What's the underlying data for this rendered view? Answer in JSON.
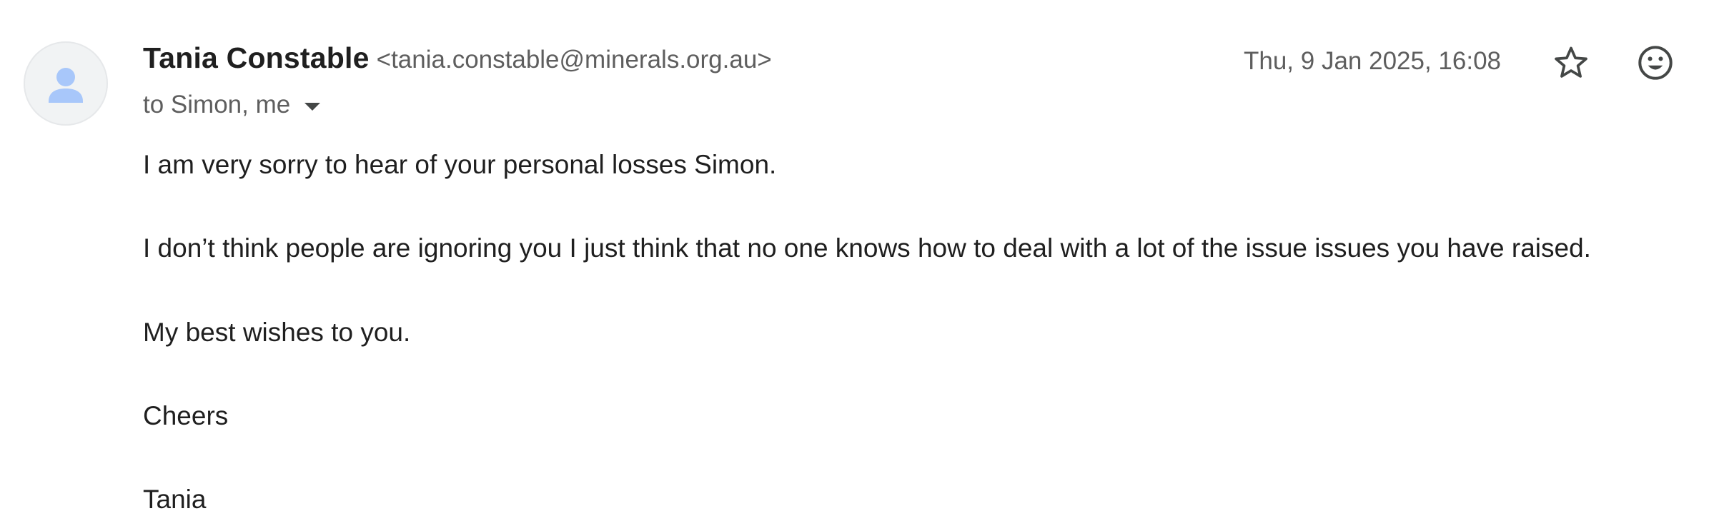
{
  "message": {
    "sender_name": "Tania Constable",
    "sender_email": "<tania.constable@minerals.org.au>",
    "date": "Thu, 9 Jan 2025, 16:08",
    "recipients": "to Simon, me",
    "body": [
      "I am very sorry to hear of your personal losses Simon.",
      "I don’t  think people are ignoring you I just think that no one knows how to deal with a lot of the issue issues you have raised.",
      "My best wishes to you.",
      "Cheers",
      "Tania"
    ]
  },
  "icons": {
    "avatar": "person-icon",
    "star": "star-icon",
    "emoji": "emoji-icon",
    "details": "chevron-down-icon"
  },
  "colors": {
    "avatar_bg": "#f1f3f4",
    "avatar_figure": "#a8c7fa",
    "secondary_text": "#5e5e5e",
    "primary_text": "#1f1f1f"
  }
}
